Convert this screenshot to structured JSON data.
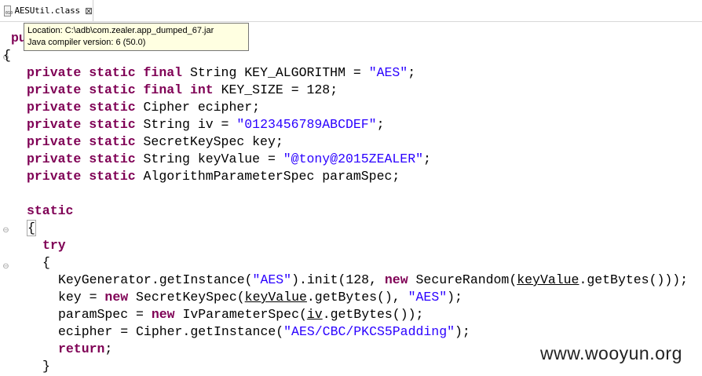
{
  "tab": {
    "icon": "class-file-icon",
    "icon_text": "010",
    "label": "AESUtil.class",
    "close": "⊠"
  },
  "tooltip": {
    "location": "Location: C:\\adb\\com.zealer.app_dumped_67.jar",
    "compiler": "Java compiler version: 6 (50.0)"
  },
  "code": {
    "l1_kw": "pu",
    "l2": "{",
    "l3": {
      "kw": "private static final",
      "text": " String KEY_ALGORITHM = ",
      "str": "\"AES\"",
      "end": ";"
    },
    "l4": {
      "kw1": "private static final",
      "kw2": "int",
      "text": " KEY_SIZE = 128;"
    },
    "l5": {
      "kw": "private static",
      "text": " Cipher ecipher;"
    },
    "l6": {
      "kw": "private static",
      "text": " String iv = ",
      "str": "\"0123456789ABCDEF\"",
      "end": ";"
    },
    "l7": {
      "kw": "private static",
      "text": " SecretKeySpec key;"
    },
    "l8": {
      "kw": "private static",
      "text": " String keyValue = ",
      "str": "\"@tony@2015ZEALER\"",
      "end": ";"
    },
    "l9": {
      "kw": "private static",
      "text": " AlgorithmParameterSpec paramSpec;"
    },
    "l10": {
      "kw": "static"
    },
    "l11": "{",
    "l12": {
      "kw": "try"
    },
    "l13": "{",
    "l14": {
      "a": "KeyGenerator.getInstance(",
      "str": "\"AES\"",
      "b": ").init(128, ",
      "kw": "new",
      "c": " SecureRandom(",
      "ul": "keyValue",
      "d": ".getBytes()));"
    },
    "l15": {
      "a": "key = ",
      "kw": "new",
      "b": " SecretKeySpec(",
      "ul": "keyValue",
      "c": ".getBytes(), ",
      "str": "\"AES\"",
      "d": ");"
    },
    "l16": {
      "a": "paramSpec = ",
      "kw": "new",
      "b": " IvParameterSpec(",
      "ul": "iv",
      "c": ".getBytes());"
    },
    "l17": {
      "a": "ecipher = Cipher.getInstance(",
      "str": "\"AES/CBC/PKCS5Padding\"",
      "b": ");"
    },
    "l18": {
      "kw": "return",
      "end": ";"
    },
    "l19": "}"
  },
  "watermark": "www.wooyun.org",
  "colors": {
    "keyword": "#7f0055",
    "string": "#2a00ff",
    "tooltip_bg": "#ffffe1"
  }
}
